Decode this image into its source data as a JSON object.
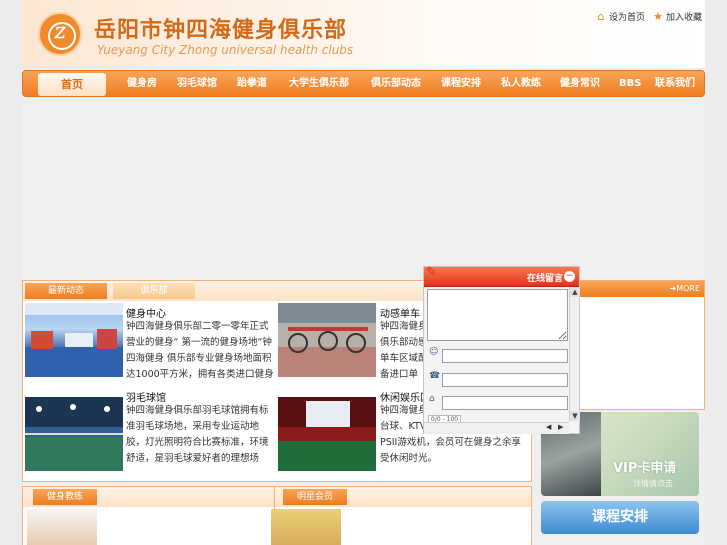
{
  "header": {
    "title": "岳阳市钟四海健身俱乐部",
    "subtitle": "Yueyang City Zhong universal health clubs",
    "set_home": "设为首页",
    "add_favorite": "加入收藏"
  },
  "nav": {
    "home": "首页",
    "items": [
      "健身房",
      "羽毛球馆",
      "跆拳道",
      "大学生俱乐部",
      "俱乐部动态",
      "课程安排",
      "私人教练",
      "健身常识",
      "BBS",
      "联系我们"
    ]
  },
  "news": {
    "tab_active": "最新动态",
    "tab_other": "俱乐部",
    "items": [
      {
        "title": "健身中心",
        "body": "钟四海健身俱乐部二零一零年正式营业的健身“ 第一流的健身场地“钟四海健身 俱乐部专业健身场地面积达1000平方米，拥有各类进口健身器械，配备专业的教练团队。"
      },
      {
        "title": "动感单车",
        "body": "钟四海健身俱乐部动感单车区域配备进口单车，由专业教练带领，伴随动感音乐，燃烧脂肪。"
      },
      {
        "title": "羽毛球馆",
        "body": "钟四海健身俱乐部羽毛球馆拥有标准羽毛球场地，采用专业运动地胶，灯光照明符合比赛标准，环境舒适，是羽毛球爱好者的理想场所。"
      },
      {
        "title": "休闲娱乐区",
        "body": "钟四海健身俱乐部休闲娱乐区设有台球、KTV等娱乐设施，并配有PSII游戏机，会员可在健身之余享受休闲时光。"
      }
    ]
  },
  "section2": {
    "left_tab": "健身教练",
    "right_tab": "明星会员"
  },
  "right": {
    "more": "MORE",
    "vip_title": "VIP卡申请",
    "vip_sub": "详情请点击",
    "course_button": "课程安排"
  },
  "popup": {
    "header_label": "在线留言",
    "close": "−",
    "counter": "0/0 - 100"
  },
  "colors": {
    "accent": "#ee7d1f",
    "title": "#d46a17",
    "popup_header": "#e4301d",
    "course_button": "#3d8ad1"
  }
}
